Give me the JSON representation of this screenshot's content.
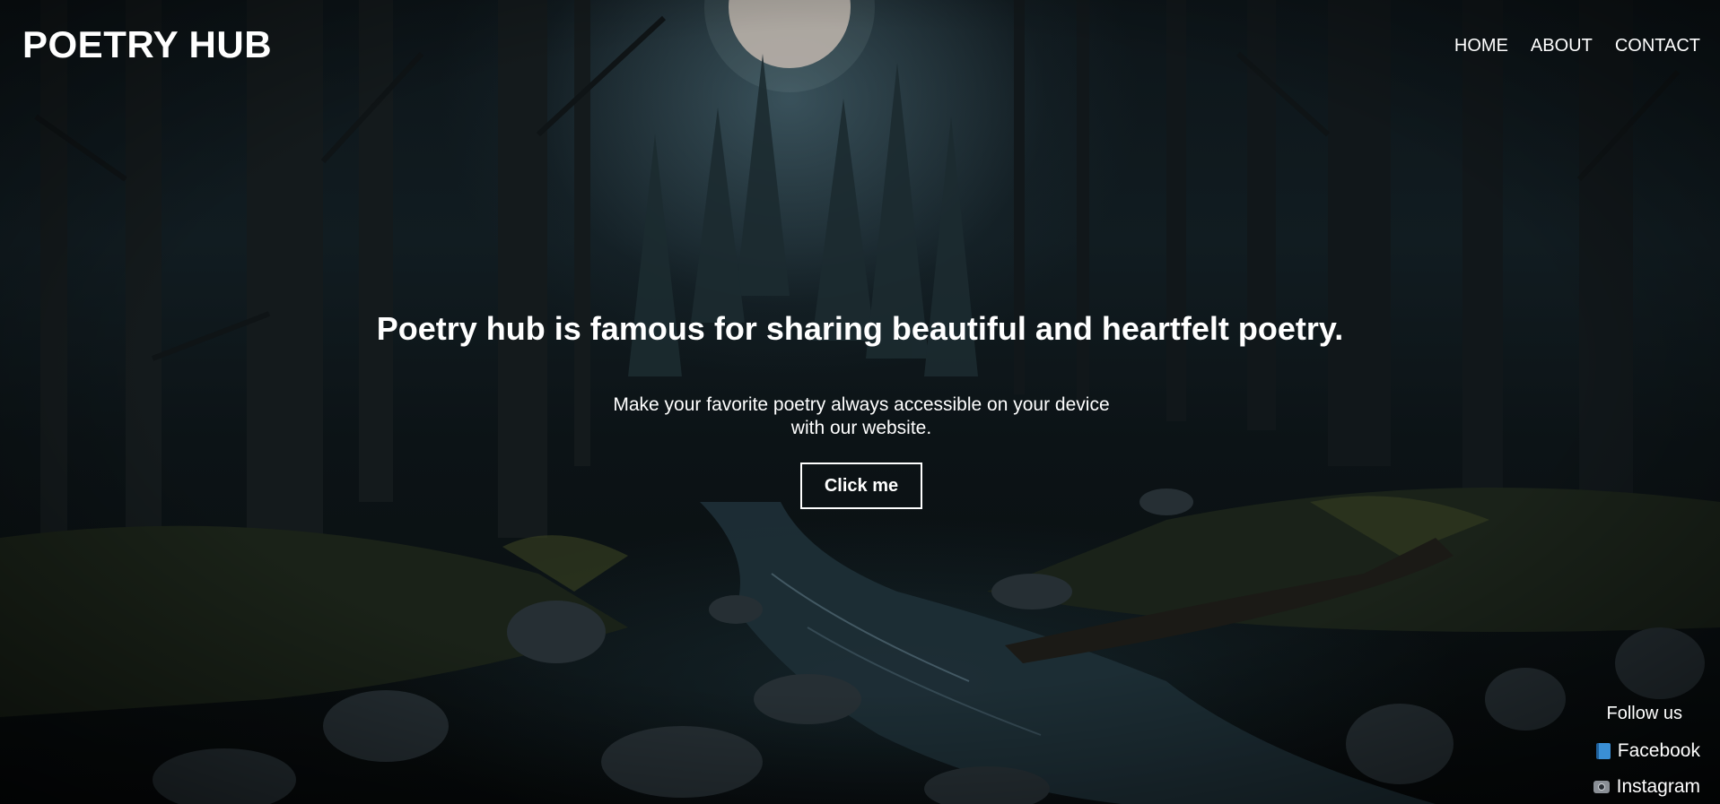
{
  "header": {
    "logo": "POETRY HUB",
    "nav": [
      "HOME",
      "ABOUT",
      "CONTACT"
    ]
  },
  "hero": {
    "title": "Poetry hub is famous for sharing beautiful and heartfelt poetry.",
    "subtitle_line1": "Make your favorite poetry always accessible on your device",
    "subtitle_line2": "with our website.",
    "button_label": "Click me"
  },
  "follow": {
    "title": "Follow us",
    "links": [
      {
        "label": "Facebook",
        "icon": "facebook-book-icon"
      },
      {
        "label": "Instagram",
        "icon": "instagram-camera-icon"
      }
    ]
  },
  "colors": {
    "text": "#ffffff",
    "background": "#0b1114",
    "moon": "#c9b8b0"
  }
}
